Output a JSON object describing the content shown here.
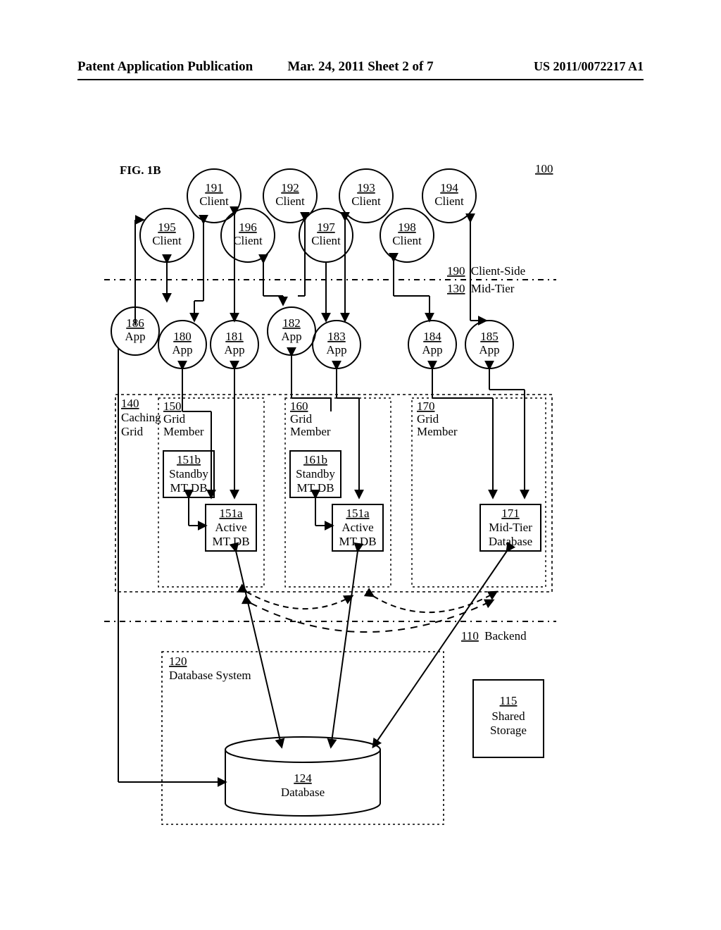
{
  "header": {
    "left": "Patent Application Publication",
    "mid": "Mar. 24, 2011  Sheet 2 of 7",
    "right": "US 2011/0072217 A1"
  },
  "fig": "FIG. 1B",
  "ref100": "100",
  "clients": {
    "c191": {
      "num": "191",
      "word": "Client"
    },
    "c192": {
      "num": "192",
      "word": "Client"
    },
    "c193": {
      "num": "193",
      "word": "Client"
    },
    "c194": {
      "num": "194",
      "word": "Client"
    },
    "c195": {
      "num": "195",
      "word": "Client"
    },
    "c196": {
      "num": "196",
      "word": "Client"
    },
    "c197": {
      "num": "197",
      "word": "Client"
    },
    "c198": {
      "num": "198",
      "word": "Client"
    }
  },
  "tiers": {
    "clientSide": {
      "num": "190",
      "word": "Client-Side"
    },
    "midTier": {
      "num": "130",
      "word": "Mid-Tier"
    },
    "backend": {
      "num": "110",
      "word": "Backend"
    }
  },
  "apps": {
    "a186": {
      "num": "186",
      "word": "App"
    },
    "a180": {
      "num": "180",
      "word": "App"
    },
    "a181": {
      "num": "181",
      "word": "App"
    },
    "a182": {
      "num": "182",
      "word": "App"
    },
    "a183": {
      "num": "183",
      "word": "App"
    },
    "a184": {
      "num": "184",
      "word": "App"
    },
    "a185": {
      "num": "185",
      "word": "App"
    }
  },
  "cachingGrid": {
    "num": "140",
    "word1": "Caching",
    "word2": "Grid"
  },
  "member150": {
    "num": "150",
    "w1": "Grid",
    "w2": "Member"
  },
  "member160": {
    "num": "160",
    "w1": "Grid",
    "w2": "Member"
  },
  "member170": {
    "num": "170",
    "w1": "Grid",
    "w2": "Member"
  },
  "standby151b": {
    "num": "151b",
    "w1": "Standby",
    "w2": "MT DB"
  },
  "standby161b": {
    "num": "161b",
    "w1": "Standby",
    "w2": "MT DB"
  },
  "active151aL": {
    "num": "151a",
    "w1": "Active",
    "w2": "MT DB"
  },
  "active151aR": {
    "num": "151a",
    "w1": "Active",
    "w2": "MT DB"
  },
  "midtierDB171": {
    "num": "171",
    "w1": "Mid-Tier",
    "w2": "Database"
  },
  "dbSystem": {
    "num": "120",
    "word": "Database System"
  },
  "database": {
    "num": "124",
    "word": "Database"
  },
  "sharedStorage": {
    "num": "115",
    "w1": "Shared",
    "w2": "Storage"
  }
}
